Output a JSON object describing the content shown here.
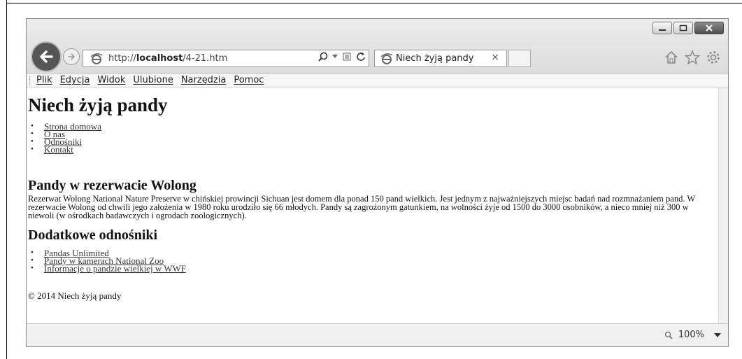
{
  "browser": {
    "address_url_prefix": "http://",
    "address_url_host": "localhost",
    "address_url_path": "/4-21.htm",
    "tab_title": "Niech żyją pandy",
    "zoom": "100%"
  },
  "menu": [
    "Plik",
    "Edycja",
    "Widok",
    "Ulubione",
    "Narzędzia",
    "Pomoc"
  ],
  "page": {
    "title": "Niech żyją pandy",
    "nav_links": [
      "Strona domowa",
      "O nas",
      "Odnośniki",
      "Kontakt"
    ],
    "section1_heading": "Pandy w rezerwacie Wolong",
    "section1_text": "Rezerwat Wolong National Nature Preserve w chińskiej prowincji Sichuan jest domem dla ponad 150 pand wielkich. Jest jednym z najważniejszych miejsc badań nad rozmnażaniem pand. W rezerwacie Wolong od chwili jego założenia w 1980 roku urodziło się 66 młodych. Pandy są zagrożonym gatunkiem, na wolności żyje od 1500 do 3000 osobników, a nieco mniej niż 300 w niewoli (w ośrodkach badawczych i ogrodach zoologicznych).",
    "section2_heading": "Dodatkowe odnośniki",
    "extra_links": [
      "Pandas Unlimited",
      "Pandy w kamerach National Zoo",
      "Informacje o pandzie wielkiej w WWF"
    ],
    "footer": "© 2014 Niech żyją pandy"
  }
}
